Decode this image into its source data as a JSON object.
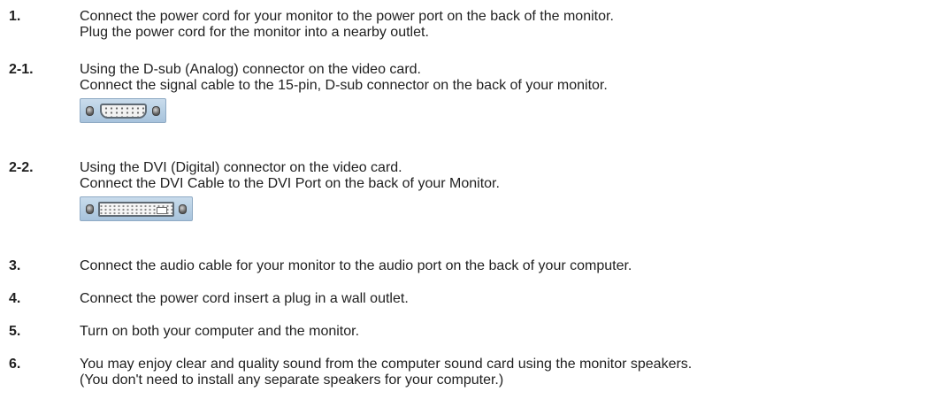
{
  "steps": [
    {
      "number": "1.",
      "lines": [
        "Connect the power cord for your monitor to the power port on the back of the monitor.",
        "Plug the power cord for the monitor into a nearby outlet."
      ]
    },
    {
      "number": "2-1.",
      "lines": [
        "Using the D-sub (Analog) connector on the video card.",
        "Connect the signal cable to the 15-pin, D-sub connector on the back of your monitor."
      ],
      "image": "d-sub-connector-icon"
    },
    {
      "number": "2-2.",
      "lines": [
        "Using the DVI (Digital) connector on the video card.",
        "Connect the DVI Cable to the DVI Port on the back of your Monitor."
      ],
      "image": "dvi-connector-icon"
    },
    {
      "number": "3.",
      "lines": [
        "Connect the audio cable for your monitor to the audio port on the back of your computer."
      ]
    },
    {
      "number": "4.",
      "lines": [
        "Connect the power cord insert a plug in a wall outlet."
      ]
    },
    {
      "number": "5.",
      "lines": [
        "Turn on both your computer and the monitor."
      ]
    },
    {
      "number": "6.",
      "lines": [
        "You may enjoy clear and quality sound from the computer sound card using the monitor speakers.",
        "(You don't need to install any separate speakers for your computer.)"
      ]
    }
  ]
}
